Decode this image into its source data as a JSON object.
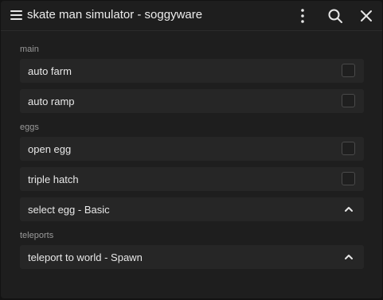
{
  "window": {
    "title": "skate man simulator - soggyware"
  },
  "icons": {
    "menu": "menu-icon",
    "more": "more-vertical-icon",
    "search": "search-icon",
    "close": "close-icon",
    "chevron": "chevron-up-icon"
  },
  "colors": {
    "background": "#1e1e1e",
    "row": "#262626",
    "text": "#e8e8e8",
    "section": "#9a9a9a"
  },
  "sections": {
    "main": {
      "label": "main",
      "auto_farm": {
        "label": "auto farm",
        "checked": false
      },
      "auto_ramp": {
        "label": "auto ramp",
        "checked": false
      }
    },
    "eggs": {
      "label": "eggs",
      "open_egg": {
        "label": "open egg",
        "checked": false
      },
      "triple_hatch": {
        "label": "triple hatch",
        "checked": false
      },
      "select_egg": {
        "label": "select egg - Basic"
      }
    },
    "teleports": {
      "label": "teleports",
      "teleport_world": {
        "label": "teleport to world - Spawn"
      }
    }
  }
}
